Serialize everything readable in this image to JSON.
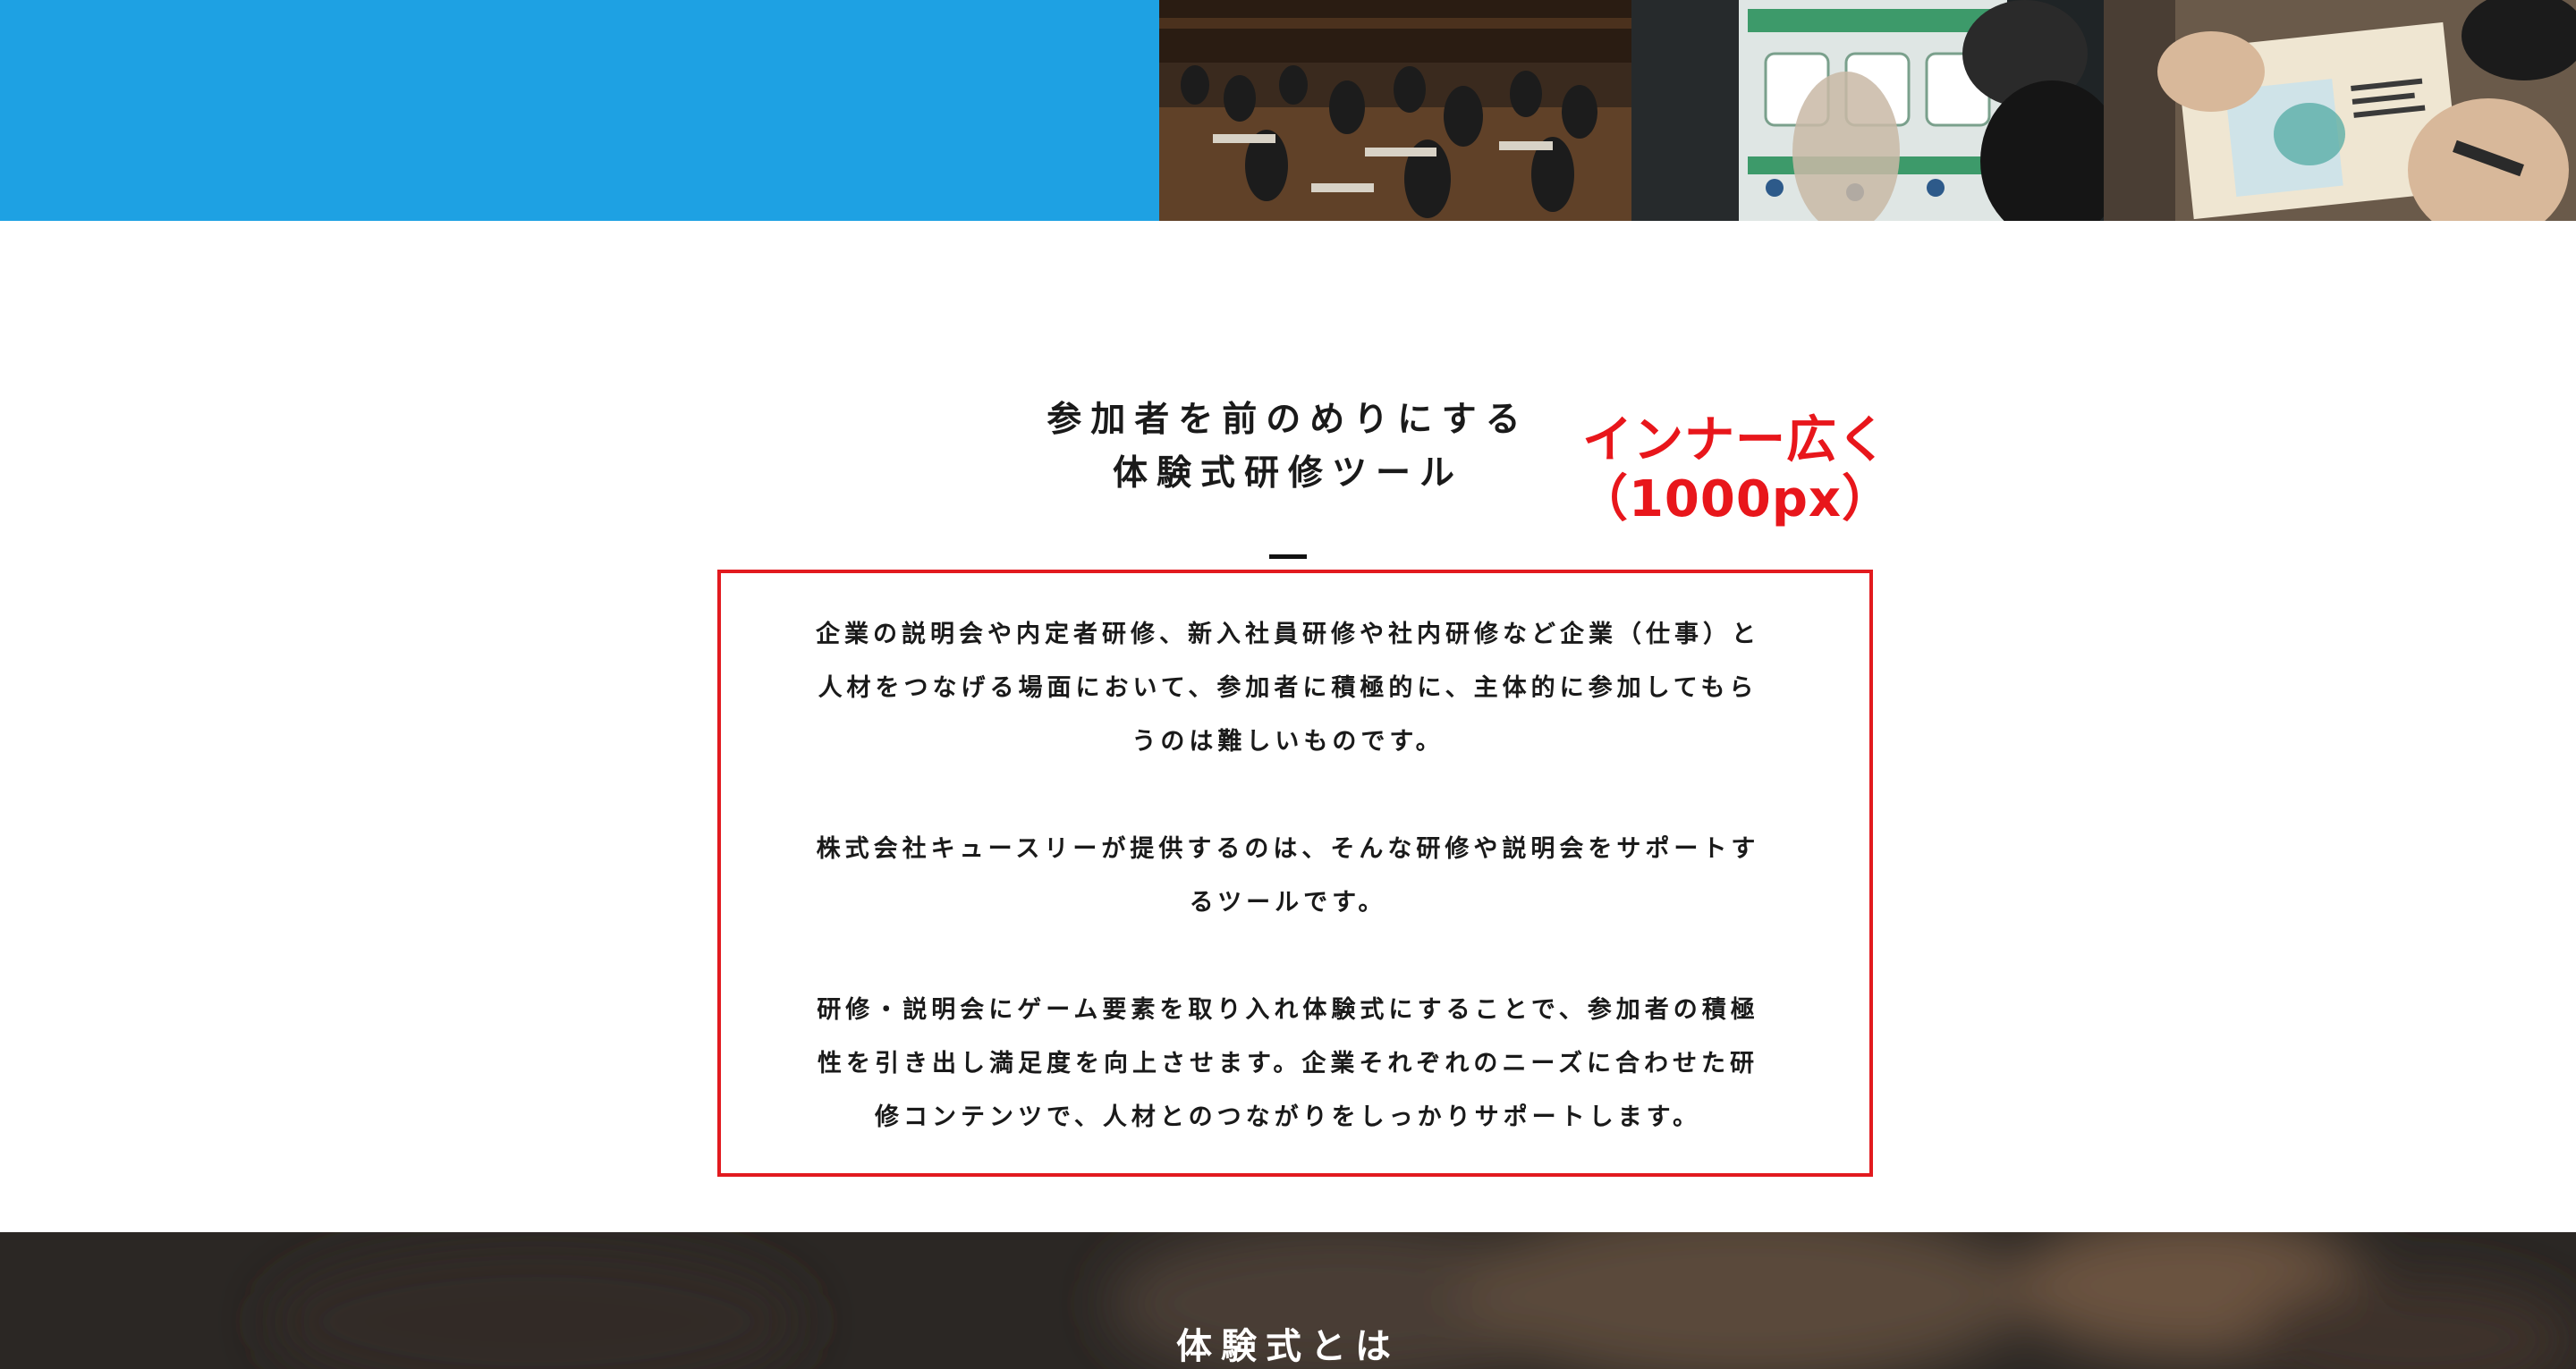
{
  "hero": {
    "accent_color": "#1ea1e3",
    "photos": [
      {
        "icon": "seminar-room-photo"
      },
      {
        "icon": "board-game-photo"
      },
      {
        "icon": "card-reading-photo"
      }
    ]
  },
  "intro": {
    "title_lines": [
      "参加者を前のめりにする",
      "体験式研修ツール"
    ],
    "paragraphs": [
      {
        "lines": [
          "企業の説明会や内定者研修、新入社員研修や社内研修など企業（仕事）と",
          "人材をつなげる場面において、参加者に積極的に、主体的に参加してもら",
          "うのは難しいものです。"
        ]
      },
      {
        "lines": [
          "株式会社キュースリーが提供するのは、そんな研修や説明会をサポートす",
          "るツールです。"
        ]
      },
      {
        "lines": [
          "研修・説明会にゲーム要素を取り入れ体験式にすることで、参加者の積極",
          "性を引き出し満足度を向上させます。企業それぞれのニーズに合わせた研",
          "修コンテンツで、人材とのつながりをしっかりサポートします。"
        ]
      }
    ]
  },
  "annotation": {
    "lines": [
      "インナー広く",
      "（1000px）"
    ],
    "color": "#e8161b"
  },
  "next_section": {
    "heading": "体験式とは"
  }
}
